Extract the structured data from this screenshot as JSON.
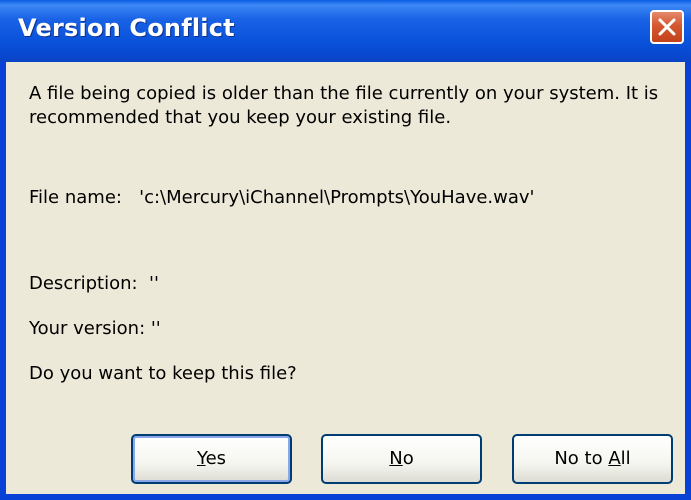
{
  "window": {
    "title": "Version Conflict"
  },
  "icons": {
    "close": "close-icon"
  },
  "message": "A file being copied is older than the file currently on your system.  It is recommended that you keep your existing file.",
  "file_name": {
    "label": "File name:",
    "value": "'c:\\Mercury\\iChannel\\Prompts\\YouHave.wav'"
  },
  "description": "Description:  ''",
  "your_version": "Your version: ''",
  "question": "Do you want to keep this file?",
  "buttons": {
    "yes": {
      "mnemonic": "Y",
      "rest": "es"
    },
    "no": {
      "mnemonic": "N",
      "rest": "o"
    },
    "no_to_all": {
      "prefix": "No to ",
      "mnemonic": "A",
      "rest": "ll"
    }
  },
  "colors": {
    "titlebar": "#0a55dd",
    "frame": "#0841d6",
    "client": "#ece9d8",
    "close_button": "#d4582f"
  }
}
